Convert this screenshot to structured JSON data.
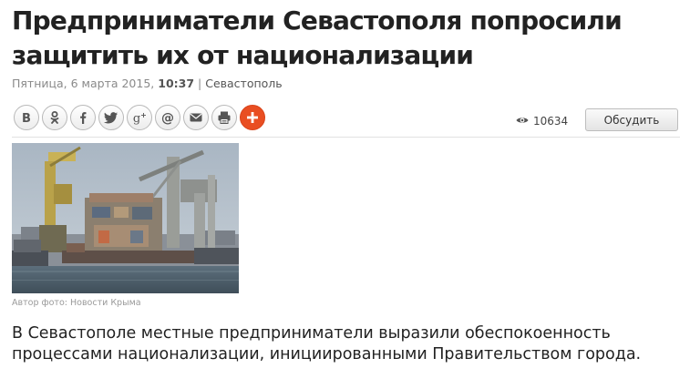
{
  "article": {
    "title": "Предприниматели Севастополя попросили защитить их от национализации",
    "date": "Пятница, 6 марта 2015, ",
    "time": "10:37",
    "separator": " | ",
    "location": "Севастополь",
    "photo_credit": "Автор фото: Новости Крыма",
    "lead": "В Севастополе местные предприниматели выразили обеспокоенность процессами национализации, инициированными Правительством города."
  },
  "share_bar": {
    "buttons": [
      {
        "name": "vk",
        "icon": "vk-icon"
      },
      {
        "name": "odnoklassniki",
        "icon": "odnoklassniki-icon"
      },
      {
        "name": "facebook",
        "icon": "facebook-icon"
      },
      {
        "name": "twitter",
        "icon": "twitter-icon"
      },
      {
        "name": "google-plus",
        "icon": "google-plus-icon"
      },
      {
        "name": "mail-ru",
        "icon": "at-icon"
      },
      {
        "name": "email",
        "icon": "envelope-icon"
      },
      {
        "name": "print",
        "icon": "printer-icon"
      },
      {
        "name": "more",
        "icon": "plus-icon"
      }
    ]
  },
  "stats": {
    "views": "10634",
    "views_icon": "eye-icon"
  },
  "actions": {
    "discuss_label": "Обсудить"
  },
  "colors": {
    "accent_plus": "#e94e22",
    "text": "#222222",
    "meta": "#8a8a8a"
  }
}
